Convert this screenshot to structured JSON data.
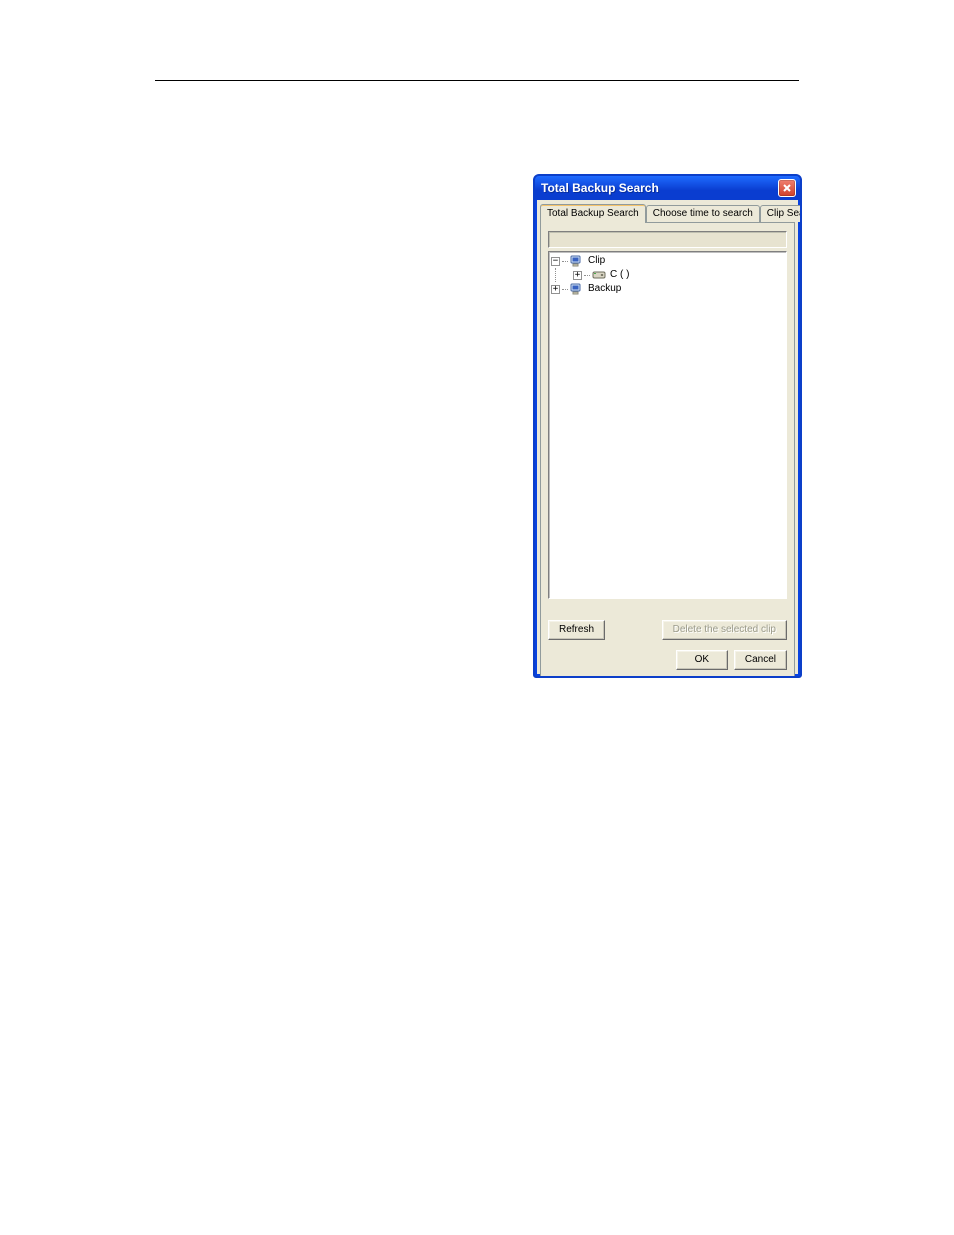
{
  "dialog": {
    "title": "Total Backup Search",
    "tabs": [
      {
        "label": "Total Backup Search",
        "active": true
      },
      {
        "label": "Choose time to search",
        "active": false
      },
      {
        "label": "Clip Search",
        "active": false
      }
    ],
    "path_value": "",
    "tree": {
      "nodes": [
        {
          "label": "Clip",
          "type": "computer",
          "expander": "−",
          "children": [
            {
              "label": "C ( )",
              "type": "drive",
              "expander": "+"
            }
          ]
        },
        {
          "label": "Backup",
          "type": "computer",
          "expander": "+"
        }
      ]
    },
    "buttons": {
      "refresh": "Refresh",
      "delete_clip": "Delete the selected clip",
      "ok": "OK",
      "cancel": "Cancel"
    }
  }
}
